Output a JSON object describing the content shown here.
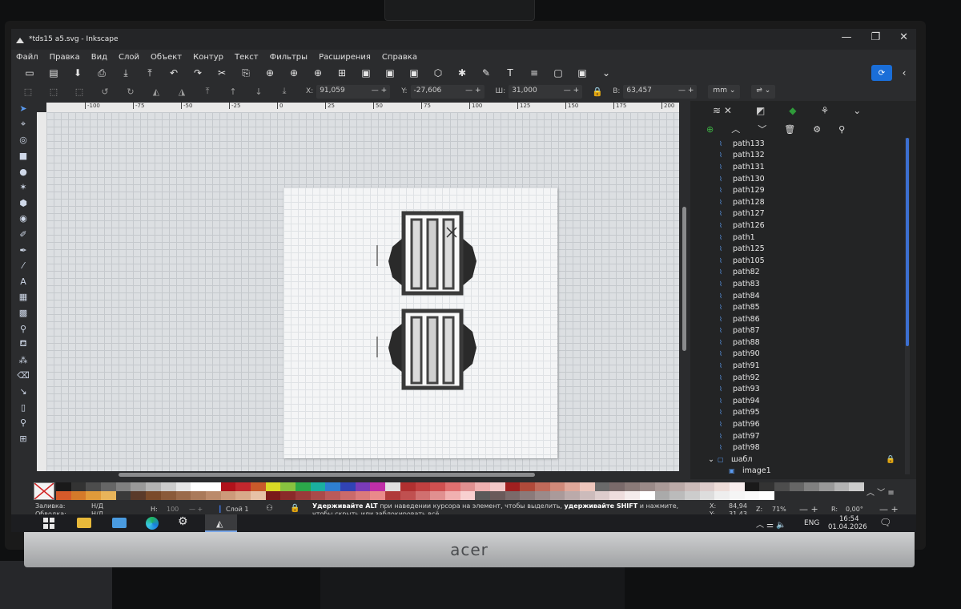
{
  "window": {
    "title": "*tds15 a5.svg - Inkscape",
    "controls": [
      "—",
      "❐",
      "✕"
    ]
  },
  "menu": [
    "Файл",
    "Правка",
    "Вид",
    "Слой",
    "Объект",
    "Контур",
    "Текст",
    "Фильтры",
    "Расширения",
    "Справка"
  ],
  "command_bar": {
    "icons": [
      "new-document-icon",
      "open-icon",
      "save-icon",
      "print-icon",
      "import-icon",
      "export-icon",
      "undo-icon",
      "redo-icon",
      "cut-icon",
      "copy-icon",
      "zoom-selection-icon",
      "zoom-drawing-icon",
      "zoom-page-icon",
      "zoom-fit-icon",
      "group-icon",
      "ungroup-icon",
      "duplicate-icon",
      "node-icon",
      "xml-editor-icon",
      "fill-stroke-icon",
      "text-icon",
      "align-icon",
      "symbols-icon",
      "document-properties-icon",
      "dropdown-icon"
    ],
    "glyphs": [
      "▭",
      "▤",
      "⬇",
      "⎙",
      "⤓",
      "⤒",
      "↶",
      "↷",
      "✂",
      "⎘",
      "⊕",
      "⊕",
      "⊕",
      "⊞",
      "▣",
      "▣",
      "▣",
      "⬡",
      "✱",
      "✎",
      "T",
      "≡",
      "▢",
      "▣",
      "⌄"
    ]
  },
  "tool_controls": {
    "x_label": "X:",
    "x_value": "91,059",
    "y_label": "Y:",
    "y_value": "-27,606",
    "w_label": "Ш:",
    "w_value": "31,000",
    "h_label": "В:",
    "h_value": "63,457",
    "unit": "mm"
  },
  "tools": [
    {
      "name": "selector-tool-icon",
      "glyph": "➤"
    },
    {
      "name": "node-tool-icon",
      "glyph": "⌖"
    },
    {
      "name": "tweak-tool-icon",
      "glyph": "◎"
    },
    {
      "name": "rect-tool-icon",
      "glyph": "■"
    },
    {
      "name": "ellipse-tool-icon",
      "glyph": "●"
    },
    {
      "name": "star-tool-icon",
      "glyph": "✶"
    },
    {
      "name": "box3d-tool-icon",
      "glyph": "⬢"
    },
    {
      "name": "spiral-tool-icon",
      "glyph": "◉"
    },
    {
      "name": "pencil-tool-icon",
      "glyph": "✐"
    },
    {
      "name": "pen-tool-icon",
      "glyph": "✒"
    },
    {
      "name": "calligraphy-tool-icon",
      "glyph": "⁄"
    },
    {
      "name": "text-tool-icon",
      "glyph": "A"
    },
    {
      "name": "gradient-tool-icon",
      "glyph": "▦"
    },
    {
      "name": "mesh-tool-icon",
      "glyph": "▩"
    },
    {
      "name": "dropper-tool-icon",
      "glyph": "⚲"
    },
    {
      "name": "paint-bucket-tool-icon",
      "glyph": "⛾"
    },
    {
      "name": "spray-tool-icon",
      "glyph": "⁂"
    },
    {
      "name": "eraser-tool-icon",
      "glyph": "⌫"
    },
    {
      "name": "connector-tool-icon",
      "glyph": "↘"
    },
    {
      "name": "pages-tool-icon",
      "glyph": "▯"
    },
    {
      "name": "zoom-tool-icon",
      "glyph": "⚲"
    },
    {
      "name": "measure-tool-icon",
      "glyph": "⊞"
    }
  ],
  "ruler_labels": [
    "-100",
    "-75",
    "-50",
    "-25",
    "0",
    "25",
    "50",
    "75",
    "100",
    "125",
    "150",
    "175",
    "200"
  ],
  "layers_panel": {
    "tabs": [
      "layers-tab-icon",
      "fill-tab-icon",
      "objects-tab-icon",
      "xml-tab-icon"
    ],
    "tab_glyphs": [
      "≋ ✕",
      "◩",
      "◆",
      "⚘",
      "⌄"
    ],
    "tool_glyphs": [
      "⊕",
      "︿",
      "﹀",
      "🗑",
      "⚙",
      "⚲"
    ],
    "items": [
      "path133",
      "path132",
      "path131",
      "path130",
      "path129",
      "path128",
      "path127",
      "path126",
      "path1",
      "path125",
      "path105",
      "path82",
      "path83",
      "path84",
      "path85",
      "path86",
      "path87",
      "path88",
      "path90",
      "path91",
      "path92",
      "path93",
      "path94",
      "path95",
      "path96",
      "path97",
      "path98"
    ],
    "group_label": "шабл",
    "child_label": "image1"
  },
  "status": {
    "fill_label": "Заливка:",
    "fill_value": "Н/Д",
    "stroke_label": "Обводка:",
    "stroke_value": "Н/Д",
    "h_label": "H:",
    "h_value": "100",
    "layer": "Слой 1",
    "hint_part1": "Удерживайте ALT",
    "hint_part2": " при наведении курсора на элемент, чтобы выделить, ",
    "hint_part3": "удерживайте SHIFT",
    "hint_part4": " и нажмите,",
    "hint_line2": "чтобы скрыть или заблокировать всё.",
    "x_label": "X:",
    "x_value": "84,94",
    "y_label": "Y:",
    "y_value": "31,43",
    "zoom_label": "Z:",
    "zoom_value": "71%",
    "rotate_label": "R:",
    "rotate_value": "0,00°"
  },
  "taskbar": {
    "icons": [
      "windows-start-icon",
      "file-explorer-icon",
      "mail-icon",
      "edge-browser-icon",
      "settings-icon",
      "inkscape-icon"
    ],
    "lang": "ENG",
    "time": "16:54",
    "date": "01.04.2026"
  },
  "monitor": {
    "brand": "acer"
  },
  "palette_colors": [
    "#1a1a1a",
    "#333333",
    "#4d4d4d",
    "#666666",
    "#808080",
    "#999999",
    "#b3b3b3",
    "#cccccc",
    "#e6e6e6",
    "#ffffff",
    "#ffffff",
    "#b0121b",
    "#c1272d",
    "#c95a2a",
    "#d9d925",
    "#88c23f",
    "#2ba84a",
    "#1ab0a0",
    "#2e7fd1",
    "#3143b5",
    "#7a3bb8",
    "#c02fa8",
    "#e0e0e0",
    "#b03030",
    "#c04040",
    "#d05050",
    "#e07070",
    "#e09090",
    "#efb0b0",
    "#f3c8c8",
    "#a02020",
    "#b04a3a",
    "#c06a5a",
    "#d08a7a",
    "#e0a89a",
    "#eec6bc",
    "#6a6a6a",
    "#7a6a6a",
    "#8a7a78",
    "#9a8a88",
    "#aa9a98",
    "#bbaaa8",
    "#ccbbb9",
    "#ddcccb",
    "#eeddd9",
    "#f8eeee",
    "#1a1a1a",
    "#333333",
    "#4d4d4d",
    "#666666",
    "#808080",
    "#999999",
    "#b3b3b3",
    "#cccccc",
    "#d55a2a",
    "#d47a2a",
    "#e09a3a",
    "#e8b45a",
    "#3a3a3a",
    "#5a3a2a",
    "#7a4a2a",
    "#8a5a3a",
    "#9a6a4a",
    "#aa7a5a",
    "#bb8a6a",
    "#cc9a7a",
    "#d8aa8a",
    "#e6c2a6",
    "#7a1a1a",
    "#8a2a2a",
    "#9a3a3a",
    "#aa4a4a",
    "#ba5a5a",
    "#ca6a6a",
    "#da7a7a",
    "#ea8a8a",
    "#b03a3a",
    "#c05050",
    "#d07070",
    "#e09090",
    "#f0b0b0",
    "#f8d0d0",
    "#5a5a5a",
    "#6a5a5a",
    "#7a6a6a",
    "#8a7a7a",
    "#9a8a8a",
    "#aa9a9a",
    "#bbaaaa",
    "#ccbbbb",
    "#ddcccc",
    "#eedddd",
    "#f5ecec",
    "#ffffff",
    "#aaaaaa",
    "#bbbbbb",
    "#cccccc",
    "#dddddd",
    "#eeeeee",
    "#f5f5f5",
    "#fafafa",
    "#ffffff"
  ]
}
